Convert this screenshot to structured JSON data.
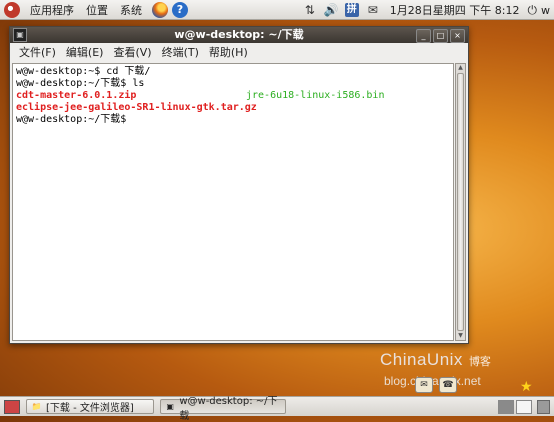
{
  "top_panel": {
    "menus": [
      "应用程序",
      "位置",
      "系统"
    ],
    "help_label": "?",
    "input_method": "拼",
    "clock": "1月28日星期四 下午 8:12",
    "user": "w",
    "icons": [
      "ubuntu-logo-icon",
      "firefox-icon",
      "help-icon",
      "network-icon",
      "volume-icon",
      "mail-icon",
      "power-icon"
    ]
  },
  "window": {
    "title": "w@w-desktop: ~/下载",
    "controls": [
      "_",
      "□",
      "×"
    ],
    "menu": [
      "文件(F)",
      "编辑(E)",
      "查看(V)",
      "终端(T)",
      "帮助(H)"
    ]
  },
  "terminal": {
    "lines": [
      {
        "text": "w@w-desktop:~$ cd 下载/"
      },
      {
        "text": "w@w-desktop:~/下载$ ls"
      }
    ],
    "files_row1_left": "cdt-master-6.0.1.zip",
    "files_row1_right": "jre-6u18-linux-i586.bin",
    "files_row2": "eclipse-jee-galileo-SR1-linux-gtk.tar.gz",
    "prompt_last": "w@w-desktop:~/下载$ "
  },
  "watermark": {
    "brand": "ChinaUnix",
    "tag": "博客",
    "site": "blog.chinaunix.net"
  },
  "taskbar": {
    "tasks": [
      {
        "label": "[下载 - 文件浏览器]",
        "icon": "folder-icon"
      },
      {
        "label": "w@w-desktop: ~/下载",
        "icon": "terminal-icon"
      }
    ]
  },
  "colors": {
    "directory_red": "#e02020",
    "executable_green": "#2cae20"
  }
}
